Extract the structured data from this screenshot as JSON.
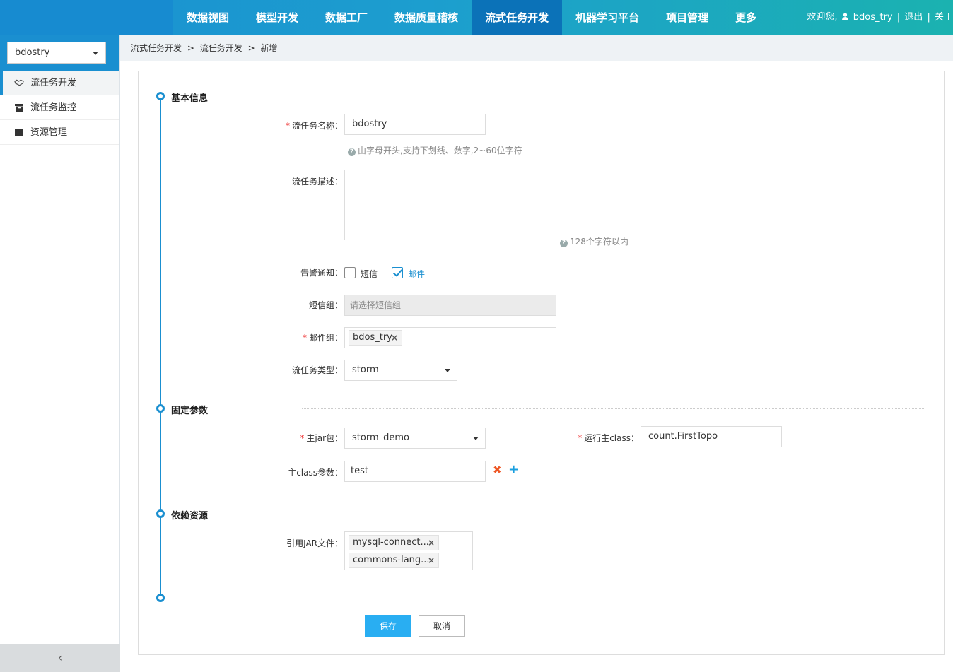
{
  "topnav": {
    "items": [
      "数据视图",
      "模型开发",
      "数据工厂",
      "数据质量稽核",
      "流式任务开发",
      "机器学习平台",
      "项目管理",
      "更多"
    ],
    "active_index": 4,
    "welcome": "欢迎您,",
    "username": "bdos_try",
    "logout": "退出",
    "about": "关于",
    "sep": "|"
  },
  "sidebar": {
    "project": "bdostry",
    "items": [
      {
        "label": "流任务开发",
        "icon": "handshake-icon",
        "active": true
      },
      {
        "label": "流任务监控",
        "icon": "archive-icon",
        "active": false
      },
      {
        "label": "资源管理",
        "icon": "server-icon",
        "active": false
      }
    ],
    "collapse": "‹"
  },
  "breadcrumb": [
    "流式任务开发",
    ">",
    "流任务开发",
    ">",
    "新增"
  ],
  "sections": {
    "basic": "基本信息",
    "fixed": "固定参数",
    "deps": "依赖资源"
  },
  "form": {
    "name_label": "流任务名称：",
    "name_value": "bdostry",
    "name_hint": "由字母开头,支持下划线、数字,2~60位字符",
    "desc_label": "流任务描述：",
    "desc_hint": "128个字符以内",
    "alert_label": "告警通知：",
    "alert_sms": "短信",
    "alert_email": "邮件",
    "sms_group_label": "短信组：",
    "sms_group_placeholder": "请选择短信组",
    "email_group_label": "邮件组：",
    "email_group_tag": "bdos_try",
    "type_label": "流任务类型：",
    "type_value": "storm",
    "jar_label": "主jar包：",
    "jar_value": "storm_demo",
    "main_class_label": "运行主class：",
    "main_class_value": "count.FirstTopo",
    "class_param_label": "主class参数：",
    "class_param_value": "test",
    "ref_jar_label": "引用JAR文件：",
    "ref_jars": [
      "mysql-connect...",
      "commons-lang..."
    ],
    "required_mark": "*",
    "remove_mark": "✖",
    "add_mark": "+"
  },
  "buttons": {
    "save": "保存",
    "cancel": "取消"
  },
  "colors": {
    "accent": "#1a8fd0",
    "primary_button": "#29aef2",
    "required": "#ee3333",
    "remove": "#ee5522"
  }
}
